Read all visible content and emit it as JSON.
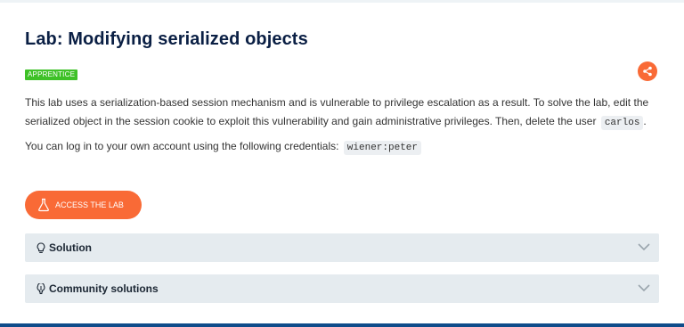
{
  "lab": {
    "title": "Lab: Modifying serialized objects",
    "level": "APPRENTICE",
    "description_part1": "This lab uses a serialization-based session mechanism and is vulnerable to privilege escalation as a result. To solve the lab, edit the serialized object in the session cookie to exploit this vulnerability and gain administrative privileges. Then, delete the user",
    "description_user": "carlos",
    "description_end": ".",
    "credentials_text": "You can log in to your own account using the following credentials:",
    "credentials": "wiener:peter",
    "access_button": "ACCESS THE LAB"
  },
  "panels": {
    "solution": "Solution",
    "community": "Community solutions"
  },
  "icons": {
    "share": "share-icon",
    "flask": "flask-icon",
    "lightbulb": "lightbulb-icon",
    "community": "community-icon",
    "chevron": "chevron-down-icon"
  },
  "colors": {
    "accent": "#f96a36",
    "badge": "#3ec127",
    "title": "#0a1f44",
    "panel": "#e5ebef",
    "footer": "#0f4c8a"
  }
}
